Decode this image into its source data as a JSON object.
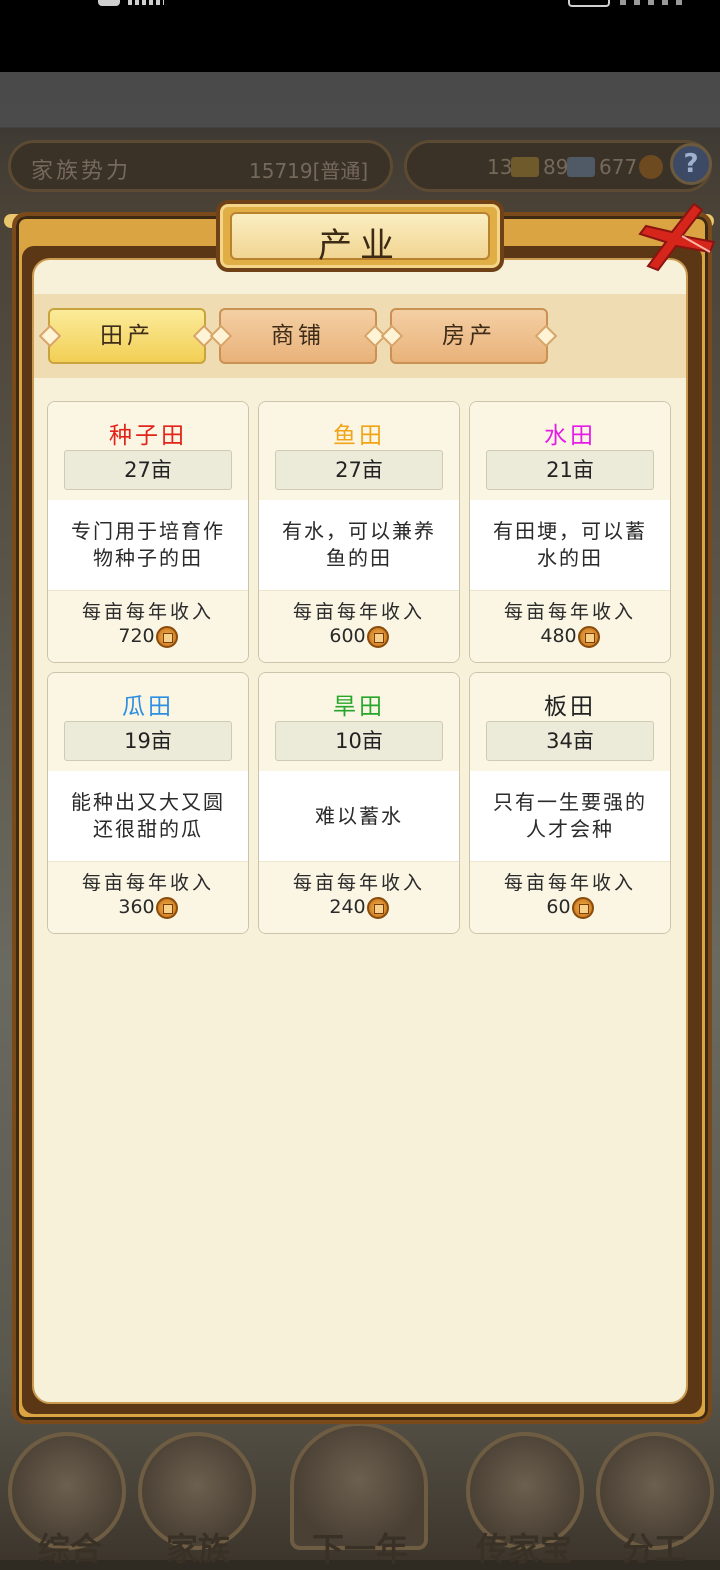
{
  "hud": {
    "family_power_label": "家族势力",
    "family_power_value": "15719[普通]",
    "gold": "13",
    "silver": "89",
    "coins": "677",
    "help": "?"
  },
  "panel": {
    "title": "产业",
    "tabs": [
      "田产",
      "商铺",
      "房产"
    ],
    "active_tab": "田产"
  },
  "fields": [
    {
      "name": "种子田",
      "color": "#e2231a",
      "area": "27亩",
      "desc": [
        "专门用于培育作",
        "物种子的田"
      ],
      "income_label": "每亩每年收入",
      "income": "720"
    },
    {
      "name": "鱼田",
      "color": "#f2a417",
      "area": "27亩",
      "desc": [
        "有水，可以兼养",
        "鱼的田"
      ],
      "income_label": "每亩每年收入",
      "income": "600"
    },
    {
      "name": "水田",
      "color": "#e51ce6",
      "area": "21亩",
      "desc": [
        "有田埂，可以蓄",
        "水的田"
      ],
      "income_label": "每亩每年收入",
      "income": "480"
    },
    {
      "name": "瓜田",
      "color": "#2d8fe0",
      "area": "19亩",
      "desc": [
        "能种出又大又圆",
        "还很甜的瓜"
      ],
      "income_label": "每亩每年收入",
      "income": "360"
    },
    {
      "name": "旱田",
      "color": "#27a62b",
      "area": "10亩",
      "desc": [
        "难以蓄水"
      ],
      "income_label": "每亩每年收入",
      "income": "240"
    },
    {
      "name": "板田",
      "color": "#222222",
      "area": "34亩",
      "desc": [
        "只有一生要强的",
        "人才会种"
      ],
      "income_label": "每亩每年收入",
      "income": "60"
    }
  ],
  "dock": [
    "综合",
    "家族",
    "下一年",
    "传家宝",
    "分工"
  ]
}
